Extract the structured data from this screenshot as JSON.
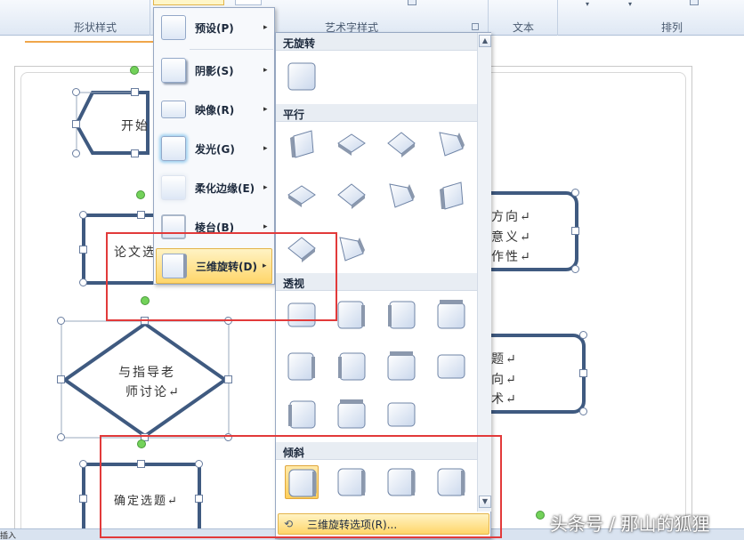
{
  "ribbon": {
    "groups": {
      "shape_styles": "形状样式",
      "wordart_styles": "艺术字样式",
      "text": "文本",
      "arrange": "排列"
    }
  },
  "flowchart": {
    "start": "开始",
    "topic": "论文选",
    "discuss_line1": "与指导老",
    "discuss_line2": "师讨论↵",
    "confirm": "确定选题↵",
    "right1_line1": "方向↵",
    "right1_line2": "意义↵",
    "right1_line3": "作性↵",
    "right2_line1": "题↵",
    "right2_line2": "向↵",
    "right2_line3": "术↵"
  },
  "menu": {
    "items": [
      {
        "label": "预设(P)"
      },
      {
        "label": "阴影(S)"
      },
      {
        "label": "映像(R)"
      },
      {
        "label": "发光(G)"
      },
      {
        "label": "柔化边缘(E)"
      },
      {
        "label": "棱台(B)"
      },
      {
        "label": "三维旋转(D)"
      }
    ],
    "arrow": "▸"
  },
  "gallery": {
    "sections": {
      "none": "无旋转",
      "parallel": "平行",
      "perspective": "透视",
      "oblique": "倾斜"
    },
    "options_label": "三维旋转选项(R)...",
    "scroll_up": "▲",
    "scroll_down": "▼"
  },
  "statusbar": {
    "text": "插入"
  },
  "watermark": "头条号 / 那山的狐狸",
  "colors": {
    "accent_highlight": "#ffd66a",
    "shape_border": "#3f5a80",
    "annotation_red": "#e23a3a"
  }
}
